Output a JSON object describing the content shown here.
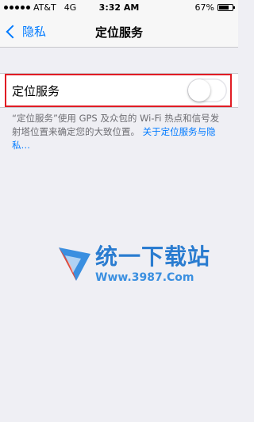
{
  "status_bar": {
    "carrier": "AT&T",
    "network": "4G",
    "time": "3:32 AM",
    "battery_percent": "67%"
  },
  "nav": {
    "back_label": "隐私",
    "title": "定位服务"
  },
  "setting": {
    "label": "定位服务",
    "toggle_on": false
  },
  "footer": {
    "text": "“定位服务”使用 GPS 及众包的 Wi-Fi 热点和信号发射塔位置来确定您的大致位置。",
    "link": "关于定位服务与隐私…"
  },
  "watermark": {
    "title": "统一下载站",
    "url": "Www.3987.Com"
  },
  "colors": {
    "accent": "#007aff",
    "highlight": "#e11c24",
    "background": "#efeff4"
  }
}
